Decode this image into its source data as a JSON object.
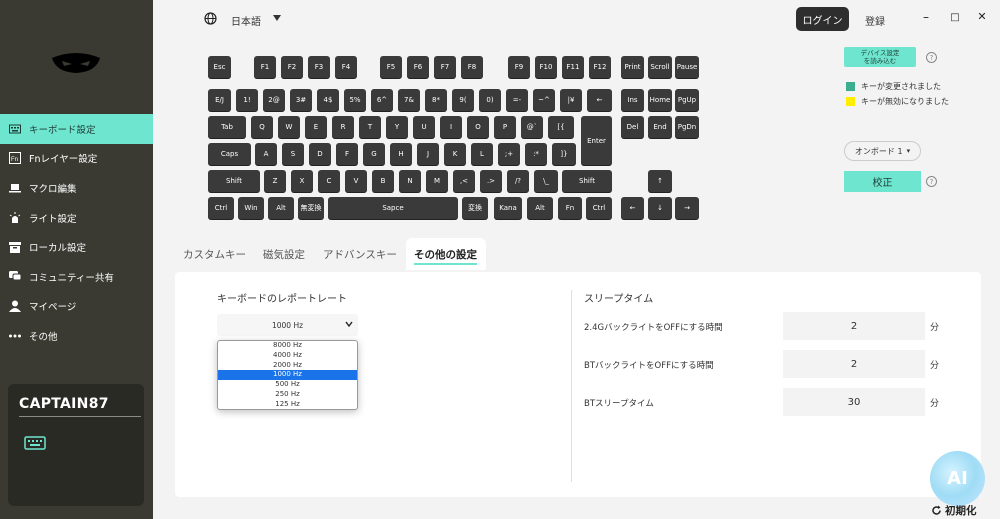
{
  "sidebar": {
    "items": [
      {
        "label": "キーボード設定",
        "icon": "keyboard-icon"
      },
      {
        "label": "Fnレイヤー設定",
        "icon": "fn-icon"
      },
      {
        "label": "マクロ編集",
        "icon": "laptop-icon"
      },
      {
        "label": "ライト設定",
        "icon": "light-icon"
      },
      {
        "label": "ローカル設定",
        "icon": "box-icon"
      },
      {
        "label": "コミュニティー共有",
        "icon": "chat-icon"
      },
      {
        "label": "マイページ",
        "icon": "user-icon"
      },
      {
        "label": "その他",
        "icon": "more-icon"
      }
    ],
    "device_name": "CAPTAIN87"
  },
  "header": {
    "language": "日本語",
    "login_label": "ログイン",
    "register_label": "登録",
    "minimize": "–",
    "maximize": "□",
    "close": "✕"
  },
  "keyboard": {
    "rows": [
      [
        "Esc",
        "F1",
        "F2",
        "F3",
        "F4",
        "F5",
        "F6",
        "F7",
        "F8",
        "F9",
        "F10",
        "F11",
        "F12",
        "Print",
        "Scroll",
        "Pause"
      ],
      [
        "E/J",
        "1!",
        "2@",
        "3#",
        "4$",
        "5%",
        "6^",
        "7&",
        "8*",
        "9(",
        "0)",
        "=-",
        "~^",
        "|¥",
        "←",
        "Ins",
        "Home",
        "PgUp"
      ],
      [
        "Tab",
        "Q",
        "W",
        "E",
        "R",
        "T",
        "Y",
        "U",
        "I",
        "O",
        "P",
        "@`",
        "[{",
        "Enter",
        "Del",
        "End",
        "PgDn"
      ],
      [
        "Caps",
        "A",
        "S",
        "D",
        "F",
        "G",
        "H",
        "J",
        "K",
        "L",
        ";+",
        ":*",
        "]}"
      ],
      [
        "Shift",
        "Z",
        "X",
        "C",
        "V",
        "B",
        "N",
        "M",
        ",<",
        ".>",
        "/?",
        "\\_",
        "Shift",
        "↑"
      ],
      [
        "Ctrl",
        "Win",
        "Alt",
        "無変換",
        "Sapce",
        "変換",
        "Kana",
        "Alt",
        "Fn",
        "Ctrl",
        "←",
        "↓",
        "→"
      ]
    ]
  },
  "right_panel": {
    "read_device_label": "デバイス設定\nを読み込む",
    "help": "?",
    "legend": [
      {
        "label": "キーが変更されました",
        "color": "#3aae8f"
      },
      {
        "label": "キーが無効になりました",
        "color": "#ffee00"
      }
    ],
    "onboard_label": "オンボード 1",
    "calibrate_label": "校正"
  },
  "tabs": [
    {
      "label": "カスタムキー"
    },
    {
      "label": "磁気設定"
    },
    {
      "label": "アドバンスキー"
    },
    {
      "label": "その他の設定"
    }
  ],
  "report_rate": {
    "title": "キーボードのレポートレート",
    "selected": "1000 Hz",
    "options": [
      "8000 Hz",
      "4000 Hz",
      "2000 Hz",
      "1000 Hz",
      "500 Hz",
      "250 Hz",
      "125 Hz"
    ]
  },
  "sleep": {
    "title": "スリープタイム",
    "rows": [
      {
        "label": "2.4GバックライトをOFFにする時間",
        "value": "2",
        "unit": "分"
      },
      {
        "label": "BTバックライトをOFFにする時間",
        "value": "2",
        "unit": "分"
      },
      {
        "label": "BTスリープタイム",
        "value": "30",
        "unit": "分"
      }
    ]
  },
  "ai_label": "AI",
  "reset_label": "初期化",
  "colors": {
    "accent": "#6ee6cf",
    "sidebar": "#3a3a33",
    "key": "#3a3a3a"
  }
}
